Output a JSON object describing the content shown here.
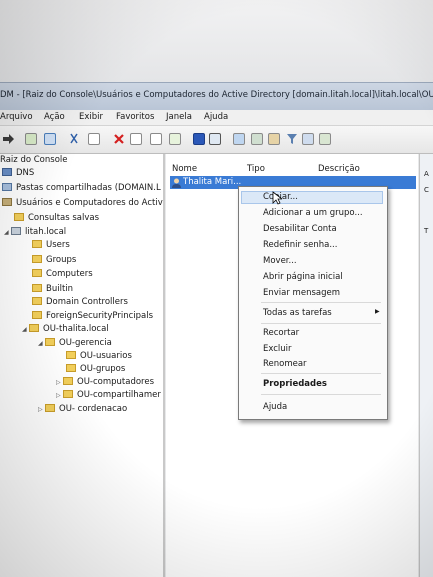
{
  "window": {
    "title": "DM - [Raiz do Console\\Usuários e Computadores do Active Directory [domain.litah.local]\\litah.local\\OU-tha"
  },
  "menu": [
    "Arquivo",
    "Ação",
    "Exibir",
    "Favoritos",
    "Janela",
    "Ajuda"
  ],
  "tree": [
    {
      "label": "Raiz do Console"
    },
    {
      "label": "DNS"
    },
    {
      "label": "Pastas compartilhadas (DOMAIN.L"
    },
    {
      "label": "Usuários e Computadores do Activ"
    },
    {
      "label": "Consultas salvas"
    },
    {
      "label": "litah.local"
    },
    {
      "label": "Users"
    },
    {
      "label": "Groups"
    },
    {
      "label": "Computers"
    },
    {
      "label": "Builtin"
    },
    {
      "label": "Domain Controllers"
    },
    {
      "label": "ForeignSecurityPrincipals"
    },
    {
      "label": "OU-thalita.local"
    },
    {
      "label": "OU-gerencia"
    },
    {
      "label": "OU-usuarios"
    },
    {
      "label": "OU-grupos"
    },
    {
      "label": "OU-computadores"
    },
    {
      "label": "OU-compartilhamer"
    },
    {
      "label": "OU- cordenacao"
    }
  ],
  "columns": [
    "Nome",
    "Tipo",
    "Descrição"
  ],
  "list": {
    "selected_item": "Thalita Mari..."
  },
  "right_edge": [
    "A",
    "C",
    "T"
  ],
  "context_menu": {
    "items": [
      "Copiar...",
      "Adicionar a um grupo...",
      "Desabilitar Conta",
      "Redefinir senha...",
      "Mover...",
      "Abrir página inicial",
      "Enviar mensagem",
      "Todas as tarefas",
      "Recortar",
      "Excluir",
      "Renomear",
      "Propriedades",
      "Ajuda"
    ],
    "submenu_arrow": "▶"
  },
  "colors": {
    "selection": "#3a7bd5",
    "folder": "#f2cf5b",
    "menu_bg": "#fafafa"
  }
}
